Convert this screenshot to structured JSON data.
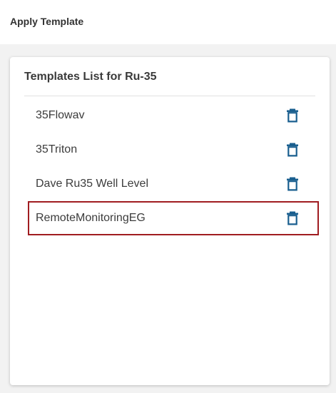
{
  "header": {
    "title": "Apply Template"
  },
  "panel": {
    "title": "Templates List for Ru-35",
    "templates": [
      {
        "name": "35Flowav",
        "selected": false
      },
      {
        "name": "35Triton",
        "selected": false
      },
      {
        "name": "Dave Ru35 Well Level",
        "selected": false
      },
      {
        "name": "RemoteMonitoringEG",
        "selected": true
      }
    ],
    "delete_icon": "trash-icon"
  },
  "colors": {
    "accent_icon": "#1a5f8f",
    "selected_border": "#a01c20"
  }
}
